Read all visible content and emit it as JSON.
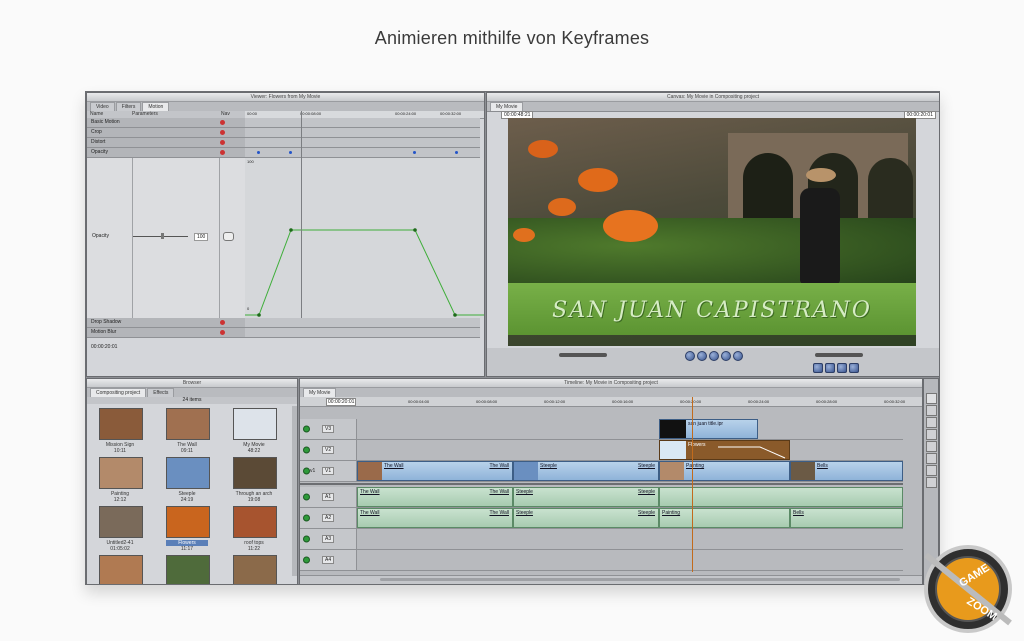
{
  "headline": "Animieren mithilfe von Keyframes",
  "viewer": {
    "title": "Viewer: Flowers from My Movie",
    "tabs": [
      "Video",
      "Filters",
      "Motion"
    ],
    "active_tab": "Motion",
    "columns": {
      "name": "Name",
      "parameters": "Parameters",
      "nav": "Nav"
    },
    "rows": [
      "Basic Motion",
      "Crop",
      "Distort",
      "Opacity"
    ],
    "opacity_label": "Opacity",
    "opacity_min": "0",
    "opacity_max": "100",
    "slider_value": "100",
    "bottom_rows": [
      "Drop Shadow",
      "Motion Blur"
    ],
    "timecode": "00:00:20:01",
    "ruler": [
      "00:00",
      "00:00:08:00",
      "00:00:16:00",
      "00:00:24:00",
      "00:00:32:00"
    ],
    "keyframes_curve": [
      0,
      0,
      100,
      100,
      0,
      0
    ]
  },
  "canvas": {
    "title": "Canvas: My Movie in Compositing project",
    "tab": "My Movie",
    "timecode": "00:00:48:21",
    "timecode_right": "00:00:20:01",
    "overlay_text": "SAN JUAN CAPISTRANO"
  },
  "browser": {
    "title": "Browser",
    "tabs": [
      "Compositing project",
      "Effects"
    ],
    "count": "24 items",
    "items": [
      {
        "name": "Mission Sign",
        "dur": "10:11",
        "color": "#8a5b3a"
      },
      {
        "name": "The Wall",
        "dur": "09:11",
        "color": "#a07050"
      },
      {
        "name": "My Movie",
        "dur": "48:22",
        "color": "#dde3ea"
      },
      {
        "name": "Painting",
        "dur": "12:12",
        "color": "#b38a6a"
      },
      {
        "name": "Steeple",
        "dur": "24:19",
        "color": "#6a8fc0"
      },
      {
        "name": "Through an arch",
        "dur": "19:08",
        "color": "#5b4a36"
      },
      {
        "name": "Untitled2-41",
        "dur": "01:05:02",
        "color": "#7a6a5a"
      },
      {
        "name": "Flowers",
        "dur": "11:17",
        "color": "#c9651e"
      },
      {
        "name": "roof tops",
        "dur": "11:22",
        "color": "#a7542f"
      },
      {
        "name": "",
        "dur": "",
        "color": "#b07a52"
      },
      {
        "name": "",
        "dur": "",
        "color": "#4f6b3b"
      },
      {
        "name": "",
        "dur": "",
        "color": "#8b6a4a"
      }
    ]
  },
  "timeline": {
    "title": "Timeline: My Movie in Compositing project",
    "tab": "My Movie",
    "timecode": "00:00:20:01",
    "ruler": [
      "00:00:04:00",
      "00:00:08:00",
      "00:00:12:00",
      "00:00:16:00",
      "00:00:20:00",
      "00:00:24:00",
      "00:00:28:00",
      "00:00:32:00"
    ],
    "tracks": {
      "v3": "V3",
      "v2": "V2",
      "v1": "V1",
      "v1src": "v1",
      "a1": "A1",
      "a2": "A2",
      "a3": "A3",
      "a4": "A4"
    },
    "clips": {
      "title": "san juan title.ipr",
      "flowers": "Flowers",
      "wall1": "The Wall",
      "wall2": "The Wall",
      "steeple1": "Steeple",
      "steeple2": "Steeple",
      "painting": "Painting",
      "bells": "Bells"
    }
  },
  "badge": {
    "line1": "GAME",
    "line2": "ZOOM"
  }
}
